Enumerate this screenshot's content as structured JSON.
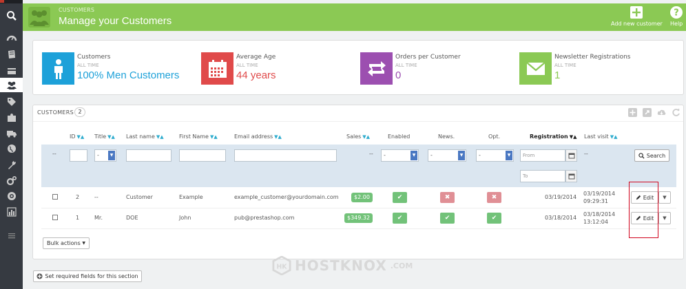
{
  "header": {
    "breadcrumb": "CUSTOMERS",
    "title": "Manage your Customers",
    "add_new_label": "Add new customer",
    "help_label": "Help",
    "color": "#8bc954"
  },
  "sidebar": {
    "items": [
      "search-icon",
      "dashboard-icon",
      "catalog-icon",
      "orders-icon",
      "customers-icon",
      "price-rules-icon",
      "modules-icon",
      "shipping-icon",
      "localization-icon",
      "preferences-icon",
      "advanced-parameters-icon",
      "administration-icon",
      "stats-icon",
      "collapse-icon"
    ],
    "active": "customers-icon"
  },
  "kpis": [
    {
      "label": "Customers",
      "sub": "ALL TIME",
      "value": "100% Men Customers",
      "color": "#1da1d9",
      "value_color": "#1da1d9",
      "icon": "man-icon"
    },
    {
      "label": "Average Age",
      "sub": "ALL TIME",
      "value": "44 years",
      "color": "#e04a4a",
      "value_color": "#e04a4a",
      "icon": "calendar-icon"
    },
    {
      "label": "Orders per Customer",
      "sub": "ALL TIME",
      "value": "0",
      "color": "#9c4fb0",
      "value_color": "#9c4fb0",
      "icon": "retweet-icon"
    },
    {
      "label": "Newsletter Registrations",
      "sub": "ALL TIME",
      "value": "1",
      "color": "#8bc954",
      "value_color": "#8bc954",
      "icon": "envelope-icon"
    }
  ],
  "list": {
    "title": "CUSTOMERS",
    "count": "2",
    "columns": {
      "id": "ID",
      "title": "Title",
      "last_name": "Last name",
      "first_name": "First Name",
      "email": "Email address",
      "sales": "Sales",
      "enabled": "Enabled",
      "news": "News.",
      "opt": "Opt.",
      "registration": "Registration",
      "last_visit": "Last visit"
    },
    "filter": {
      "dashes": "--",
      "select_placeholder": "-",
      "from_placeholder": "From",
      "to_placeholder": "To",
      "search_label": "Search"
    },
    "rows": [
      {
        "id": "2",
        "title": "--",
        "last_name": "Customer",
        "first_name": "Example",
        "email": "example_customer@yourdomain.com",
        "sales": "$2.00",
        "enabled": true,
        "news": false,
        "opt": false,
        "registration": "03/19/2014",
        "last_visit_date": "03/19/2014",
        "last_visit_time": "09:29:31",
        "edit_label": "Edit"
      },
      {
        "id": "1",
        "title": "Mr.",
        "last_name": "DOE",
        "first_name": "John",
        "email": "pub@prestashop.com",
        "sales": "$349.32",
        "enabled": true,
        "news": true,
        "opt": true,
        "registration": "03/18/2014",
        "last_visit_date": "03/18/2014",
        "last_visit_time": "13:12:04",
        "edit_label": "Edit"
      }
    ],
    "bulk_actions_label": "Bulk actions"
  },
  "footer": {
    "required_fields_label": "Set required fields for this section"
  },
  "watermark": {
    "text": "HOSTKNOX",
    "domain": ".COM"
  }
}
